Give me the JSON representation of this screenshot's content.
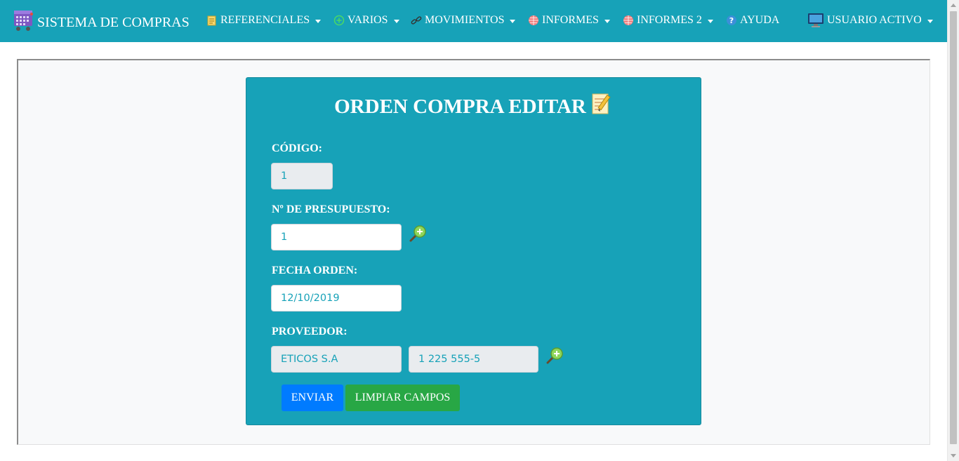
{
  "navbar": {
    "brand": "SISTEMA DE COMPRAS",
    "items": [
      {
        "label": "REFERENCIALES",
        "icon": "notepad-icon"
      },
      {
        "label": "VARIOS",
        "icon": "plus-circle-icon"
      },
      {
        "label": "MOVIMIENTOS",
        "icon": "link-icon"
      },
      {
        "label": "INFORMES",
        "icon": "globe-icon"
      },
      {
        "label": "INFORMES 2",
        "icon": "globe-icon"
      },
      {
        "label": "AYUDA",
        "icon": "help-icon"
      },
      {
        "label": "USUARIO ACTIVO",
        "icon": "monitor-icon"
      }
    ]
  },
  "form": {
    "title": "ORDEN COMPRA EDITAR",
    "codigo": {
      "label": "CÓDIGO:",
      "value": "1"
    },
    "presupuesto": {
      "label": "Nº DE PRESUPUESTO:",
      "value": "1"
    },
    "fecha": {
      "label": "FECHA ORDEN:",
      "value": "12/10/2019"
    },
    "proveedor": {
      "label": "PROVEEDOR:",
      "name": "ETICOS S.A",
      "ruc": "1 225 555-5"
    },
    "buttons": {
      "send": "ENVIAR",
      "clear": "LIMPIAR CAMPOS"
    }
  },
  "colors": {
    "primary": "#17a2b8",
    "send": "#007bff",
    "clear": "#28a745"
  }
}
